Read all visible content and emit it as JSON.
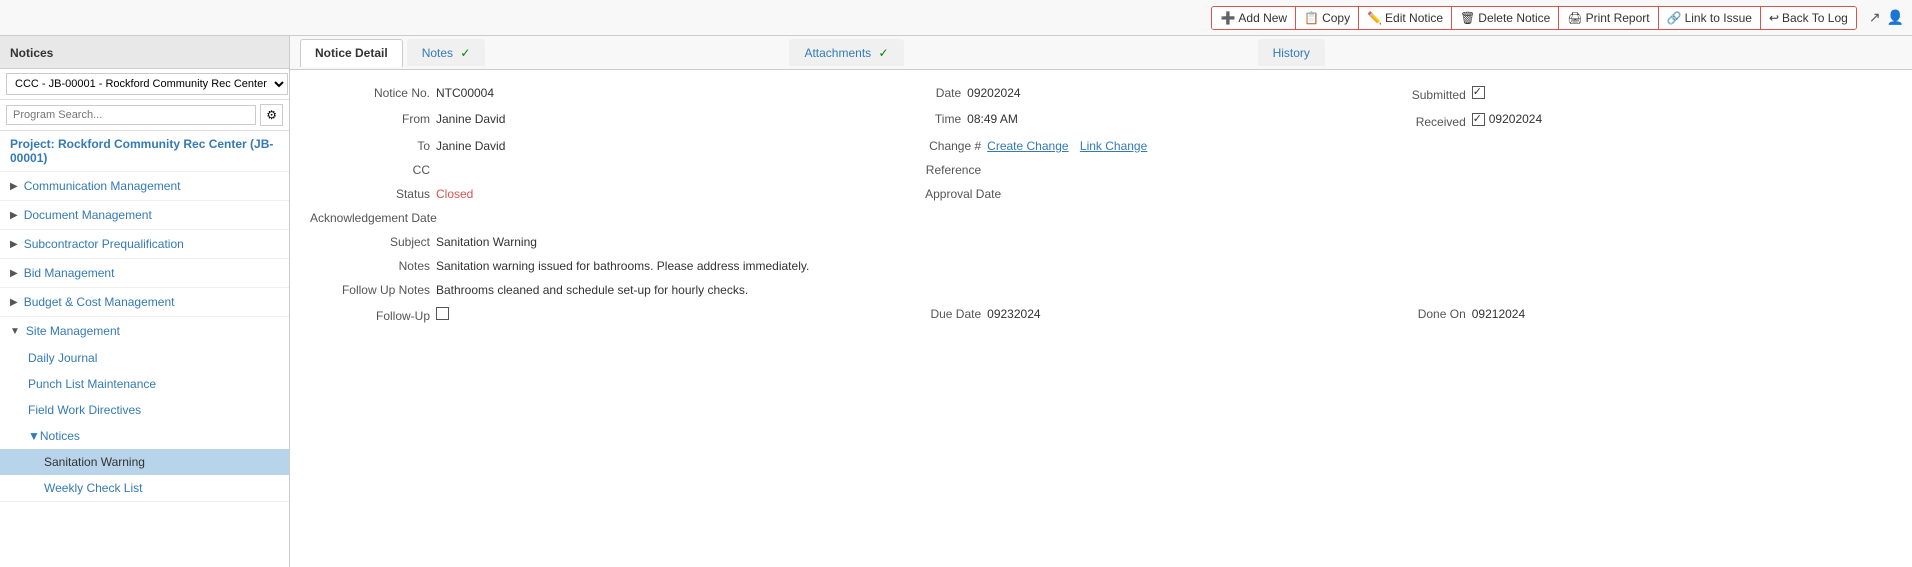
{
  "app": {
    "title": "Notices"
  },
  "toolbar": {
    "buttons": [
      {
        "id": "add-new",
        "label": "Add New",
        "icon": "➕"
      },
      {
        "id": "copy",
        "label": "Copy",
        "icon": "📋"
      },
      {
        "id": "edit-notice",
        "label": "Edit Notice",
        "icon": "✏️"
      },
      {
        "id": "delete-notice",
        "label": "Delete Notice",
        "icon": "🗑"
      },
      {
        "id": "print-report",
        "label": "Print Report",
        "icon": "🖨"
      },
      {
        "id": "link-to-issue",
        "label": "Link to Issue",
        "icon": "🔗"
      },
      {
        "id": "back-to-log",
        "label": "Back To Log",
        "icon": "↩"
      }
    ]
  },
  "sidebar": {
    "title": "Notices",
    "select_value": "CCC - JB-00001 - Rockford Community Rec Center",
    "search_placeholder": "Program Search...",
    "project_label": "Project: Rockford Community Rec Center (JB-00001)",
    "nav": [
      {
        "id": "communication-management",
        "label": "Communication Management",
        "expanded": false,
        "level": 0
      },
      {
        "id": "document-management",
        "label": "Document Management",
        "expanded": false,
        "level": 0
      },
      {
        "id": "subcontractor-prequalification",
        "label": "Subcontractor Prequalification",
        "expanded": false,
        "level": 0
      },
      {
        "id": "bid-management",
        "label": "Bid Management",
        "expanded": false,
        "level": 0
      },
      {
        "id": "budget-cost-management",
        "label": "Budget & Cost Management",
        "expanded": false,
        "level": 0
      },
      {
        "id": "site-management",
        "label": "Site Management",
        "expanded": true,
        "level": 0,
        "children": [
          {
            "id": "daily-journal",
            "label": "Daily Journal",
            "level": 1
          },
          {
            "id": "punch-list-maintenance",
            "label": "Punch List Maintenance",
            "level": 1
          },
          {
            "id": "field-work-directives",
            "label": "Field Work Directives",
            "level": 1
          },
          {
            "id": "notices",
            "label": "Notices",
            "expanded": true,
            "level": 1,
            "children": [
              {
                "id": "sanitation-warning",
                "label": "Sanitation Warning",
                "level": 2,
                "selected": true
              },
              {
                "id": "weekly-check-list",
                "label": "Weekly Check List",
                "level": 2
              }
            ]
          }
        ]
      }
    ]
  },
  "content": {
    "tabs": [
      {
        "id": "notice-detail",
        "label": "Notice Detail",
        "active": true,
        "check": false
      },
      {
        "id": "notes",
        "label": "Notes",
        "active": false,
        "check": true
      },
      {
        "id": "attachments",
        "label": "Attachments",
        "active": false,
        "check": true
      },
      {
        "id": "history",
        "label": "History",
        "active": false,
        "check": false
      }
    ],
    "notice": {
      "notice_no_label": "Notice No.",
      "notice_no": "NTC00004",
      "from_label": "From",
      "from": "Janine David",
      "to_label": "To",
      "to": "Janine David",
      "cc_label": "CC",
      "cc": "",
      "status_label": "Status",
      "status": "Closed",
      "acknowledgement_date_label": "Acknowledgement Date",
      "acknowledgement_date": "",
      "subject_label": "Subject",
      "subject": "Sanitation Warning",
      "notes_label": "Notes",
      "notes": "Sanitation warning issued for bathrooms. Please address immediately.",
      "follow_up_notes_label": "Follow Up Notes",
      "follow_up_notes": "Bathrooms cleaned and schedule set-up for hourly checks.",
      "follow_up_label": "Follow-Up",
      "follow_up_checked": false,
      "date_label": "Date",
      "date": "09202024",
      "time_label": "Time",
      "time": "08:49 AM",
      "change_label": "Change #",
      "create_change_label": "Create Change",
      "link_change_label": "Link Change",
      "reference_label": "Reference",
      "reference": "",
      "approval_date_label": "Approval Date",
      "approval_date": "",
      "due_date_label": "Due Date",
      "due_date": "09232024",
      "submitted_label": "Submitted",
      "submitted_checked": true,
      "received_label": "Received",
      "received_checked": true,
      "received_date": "09202024",
      "done_on_label": "Done On",
      "done_on": "09212024"
    }
  }
}
